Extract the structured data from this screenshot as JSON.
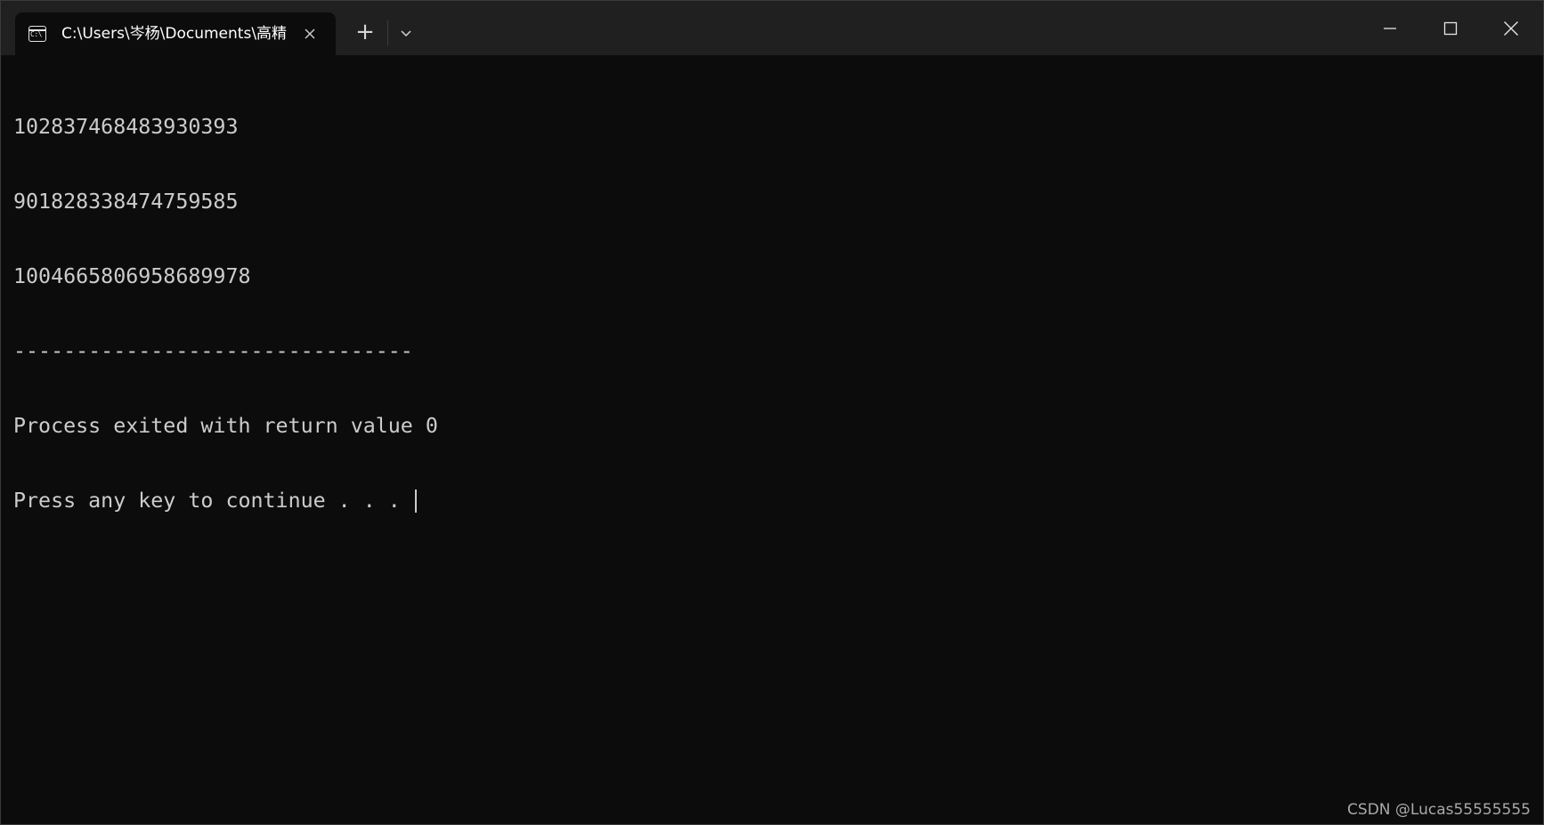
{
  "window": {
    "tab": {
      "icon": "cmd-icon",
      "icon_text": "C:\\",
      "title": "C:\\Users\\岑杨\\Documents\\高精"
    },
    "new_tab_symbol": "+",
    "controls": {
      "minimize": "minimize-icon",
      "maximize": "maximize-icon",
      "close": "close-icon"
    }
  },
  "terminal": {
    "lines": [
      "102837468483930393",
      "901828338474759585",
      "1004665806958689978",
      "--------------------------------",
      "Process exited with return value 0",
      "Press any key to continue . . . "
    ]
  },
  "watermark": "CSDN @Lucas55555555",
  "colors": {
    "background": "#0c0c0c",
    "titlebar": "#202020",
    "text": "#cccccc"
  }
}
